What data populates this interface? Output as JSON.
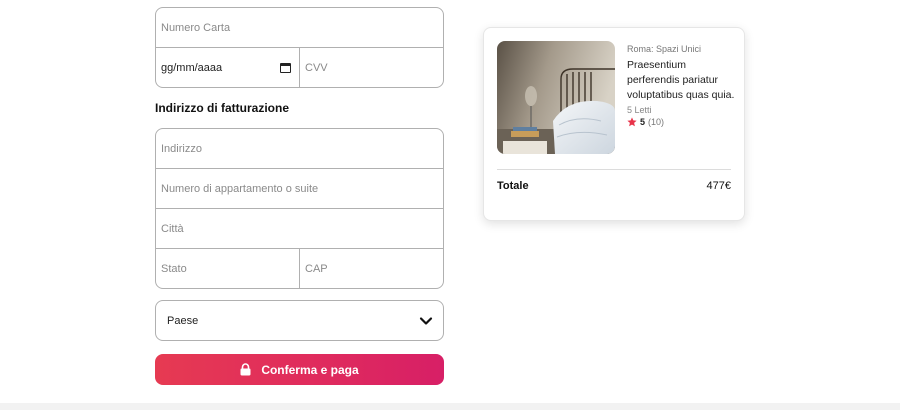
{
  "payment": {
    "card_number_placeholder": "Numero Carta",
    "expiry_value": "gg/mm/aaaa",
    "cvv_placeholder": "CVV"
  },
  "billing": {
    "title": "Indirizzo di fatturazione",
    "address_placeholder": "Indirizzo",
    "apartment_placeholder": "Numero di appartamento o suite",
    "city_placeholder": "Città",
    "state_placeholder": "Stato",
    "zip_placeholder": "CAP",
    "country_label": "Paese"
  },
  "cta": {
    "label": "Conferma e paga",
    "icon": "lock-icon"
  },
  "summary": {
    "location": "Roma: Spazi Unici",
    "description": "Praesentium perferendis pariatur voluptatibus quas quia.",
    "beds": "5 Letti",
    "rating": "5",
    "reviews": "(10)",
    "total_label": "Totale",
    "total_value": "477€"
  },
  "colors": {
    "accent_start": "#e63a52",
    "accent_end": "#d71f66",
    "star": "#e8334a"
  }
}
